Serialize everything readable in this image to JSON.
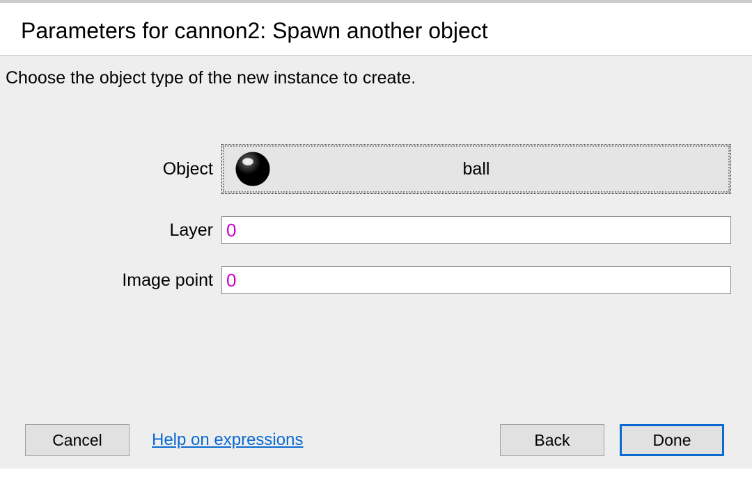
{
  "header": {
    "title": "Parameters for cannon2: Spawn another object"
  },
  "instruction": "Choose the object type of the new instance to create.",
  "fields": {
    "object": {
      "label": "Object",
      "selected_name": "ball",
      "icon": "ball-icon"
    },
    "layer": {
      "label": "Layer",
      "value": "0"
    },
    "image_point": {
      "label": "Image point",
      "value": "0"
    }
  },
  "buttons": {
    "cancel": "Cancel",
    "help": "Help on expressions",
    "back": "Back",
    "done": "Done"
  }
}
